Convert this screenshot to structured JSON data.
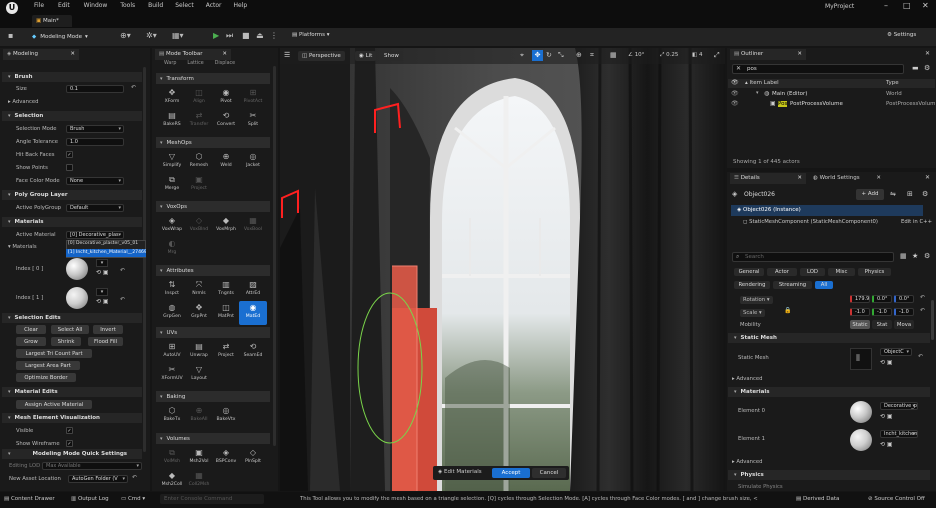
{
  "menu": {
    "items": [
      "File",
      "Edit",
      "Window",
      "Tools",
      "Build",
      "Select",
      "Actor",
      "Help"
    ],
    "project": "MyProject"
  },
  "tab": {
    "label": "Main*"
  },
  "toolbar": {
    "mode": "Modeling Mode",
    "platforms": "Platforms",
    "settings": "Settings"
  },
  "modeling_panel": {
    "title": "Modeling",
    "brush": {
      "header": "Brush",
      "size_label": "Size",
      "size_value": "0.1",
      "advanced": "Advanced"
    },
    "selection": {
      "header": "Selection",
      "mode_label": "Selection Mode",
      "mode_value": "Brush",
      "angle_label": "Angle Tolerance",
      "angle_value": "1.0",
      "hit_label": "Hit Back Faces",
      "points_label": "Show Points",
      "face_label": "Face Color Mode",
      "face_value": "None"
    },
    "polygroup": {
      "header": "Poly Group Layer",
      "active_label": "Active PolyGroup",
      "active_value": "Default"
    },
    "materials": {
      "header": "Materials",
      "active_label": "Active Material",
      "active_value": "[0] Decorative_plas",
      "options": [
        "[0] Decorative_plaster_v05_01",
        "[1] Incht_kitchen_Material__2746929526"
      ],
      "list_label": "Materials",
      "index0": "Index [ 0 ]",
      "index1": "Index [ 1 ]"
    },
    "selection_edits": {
      "header": "Selection Edits",
      "buttons": [
        "Clear",
        "Select All",
        "Invert",
        "Grow",
        "Shrink",
        "Flood Fill",
        "Largest Tri Count Part",
        "Largest Area Part",
        "Optimize Border"
      ]
    },
    "material_edits": {
      "header": "Material Edits",
      "assign": "Assign Active Material"
    },
    "mesh_vis": {
      "header": "Mesh Element Visualization",
      "visible": "Visible",
      "wireframe": "Show Wireframe"
    },
    "quick_settings": {
      "header": "Modeling Mode Quick Settings",
      "editing_lod_label": "Editing LOD",
      "editing_lod_value": "Max Available",
      "new_asset_label": "New Asset Location",
      "new_asset_value": "AutoGen Folder (V"
    }
  },
  "mode_toolbar": {
    "title": "Mode Toolbar",
    "top_labels": [
      "Warp",
      "Lattice",
      "Displace"
    ],
    "sections": [
      {
        "name": "Transform",
        "tools": [
          [
            "XForm",
            false
          ],
          [
            "Align",
            true
          ],
          [
            "Pivot",
            false
          ],
          [
            "PivotAct",
            true
          ],
          [
            "BakeRS",
            false
          ],
          [
            "Transfer",
            true
          ],
          [
            "Convert",
            false
          ],
          [
            "Split",
            false
          ]
        ]
      },
      {
        "name": "MeshOps",
        "tools": [
          [
            "Simplify",
            false
          ],
          [
            "Remesh",
            false
          ],
          [
            "Weld",
            false
          ],
          [
            "Jacket",
            false
          ],
          [
            "Merge",
            false
          ],
          [
            "Project",
            true
          ]
        ]
      },
      {
        "name": "VoxOps",
        "tools": [
          [
            "VoxWrap",
            false
          ],
          [
            "VoxBlnd",
            true
          ],
          [
            "VoxMrph",
            false
          ],
          [
            "VoxBool",
            true
          ],
          [
            "Mrg",
            true
          ]
        ]
      },
      {
        "name": "Attributes",
        "tools": [
          [
            "Inspct",
            false
          ],
          [
            "Nrmls",
            false
          ],
          [
            "Tngnts",
            false
          ],
          [
            "AttrEd",
            false
          ],
          [
            "GrpGen",
            false
          ],
          [
            "GrpPnt",
            false
          ],
          [
            "MatPnt",
            false
          ],
          [
            "MatEd",
            false
          ]
        ]
      },
      {
        "name": "UVs",
        "tools": [
          [
            "AutoUV",
            false
          ],
          [
            "Unwrap",
            false
          ],
          [
            "Project",
            false
          ],
          [
            "SeamEd",
            false
          ],
          [
            "XFormUV",
            false
          ],
          [
            "Layout",
            false
          ]
        ]
      },
      {
        "name": "Baking",
        "tools": [
          [
            "BakeTx",
            false
          ],
          [
            "BakeAll",
            true
          ],
          [
            "BakeVtx",
            false
          ]
        ]
      },
      {
        "name": "Volumes",
        "tools": [
          [
            "VolMsh",
            true
          ],
          [
            "Msh2Vol",
            false
          ],
          [
            "BSPConv",
            false
          ],
          [
            "PlnSplt",
            false
          ],
          [
            "Msh2Coll",
            false
          ],
          [
            "Coll2Msh",
            true
          ]
        ]
      }
    ]
  },
  "viewport": {
    "perspective": "Perspective",
    "lit": "Lit",
    "show": "Show",
    "angle": "10°",
    "scale": "0.25",
    "cam": "4",
    "edit_materials": "Edit Materials",
    "accept": "Accept",
    "cancel": "Cancel"
  },
  "outliner": {
    "title": "Outliner",
    "search": "pos",
    "col_label": "Item Label",
    "col_type": "Type",
    "rows": [
      {
        "label": "Main (Editor)",
        "type": "World"
      },
      {
        "label": "PostProcessVolume",
        "type": "PostProcessVolume"
      }
    ],
    "highlight": "Pos",
    "status": "Showing 1 of 445 actors"
  },
  "details": {
    "title": "Details",
    "world_settings": "World Settings",
    "object": "Object026",
    "add": "+ Add",
    "instance": "Object026 (Instance)",
    "component": "StaticMeshComponent (StaticMeshComponent0)",
    "edit_cpp": "Edit in C++",
    "search_placeholder": "Search",
    "tabs_row1": [
      "General",
      "Actor",
      "LOD",
      "Misc",
      "Physics"
    ],
    "tabs_row2": [
      "Rendering",
      "Streaming",
      "All"
    ],
    "rotation_label": "Rotation",
    "rotation": [
      "179.9",
      "0.0°",
      "0.0°"
    ],
    "scale_label": "Scale",
    "scale": [
      "-1.0",
      "-1.0",
      "-1.0"
    ],
    "mobility_label": "Mobility",
    "mobility": [
      "Static",
      "Stat",
      "Mova"
    ],
    "static_mesh_header": "Static Mesh",
    "static_mesh_label": "Static Mesh",
    "static_mesh_value": "ObjectC",
    "advanced": "Advanced",
    "materials_header": "Materials",
    "element0": "Element 0",
    "element0_value": "Decorative_pl",
    "element1": "Element 1",
    "element1_value": "Incht_kitchen",
    "physics": "Physics",
    "physics_sub": "Simulate Physics"
  },
  "statusbar": {
    "content_drawer": "Content Drawer",
    "output_log": "Output Log",
    "cmd": "Cmd",
    "console_placeholder": "Enter Console Command",
    "message": "This Tool allows you to modify the mesh based on a triangle selection. [Q] cycles through Selection Mode. [A] cycles through Face Color modes. [ and ] change brush size, <",
    "derived": "Derived Data",
    "source_control": "Source Control Off"
  }
}
